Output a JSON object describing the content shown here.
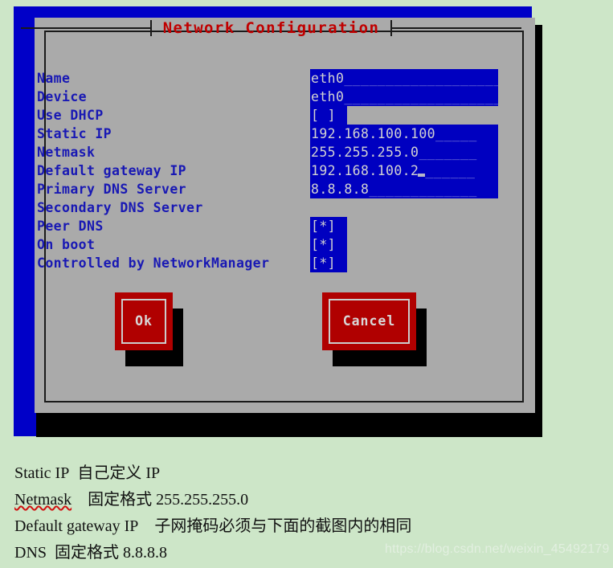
{
  "dialog": {
    "title": "Network Configuration",
    "rows": [
      {
        "label": "Name",
        "type": "text",
        "value": "eth0",
        "fill": "____________________"
      },
      {
        "label": "Device",
        "type": "text",
        "value": "eth0",
        "fill": "____________________"
      },
      {
        "label": "Use DHCP",
        "type": "checkbox",
        "value": "[ ]"
      },
      {
        "label": "Static IP",
        "type": "text",
        "value": "192.168.100.100",
        "fill": "_____"
      },
      {
        "label": "Netmask",
        "type": "text",
        "value": "255.255.255.0",
        "fill": "_______"
      },
      {
        "label": "Default gateway IP",
        "type": "text",
        "value": "192.168.100.2",
        "fill": "______",
        "cursor": true
      },
      {
        "label": "Primary DNS Server",
        "type": "text",
        "value": "8.8.8.8",
        "fill": "_____________"
      },
      {
        "label": "Secondary DNS Server",
        "type": "text",
        "value": "",
        "fill": ""
      },
      {
        "label": "Peer DNS",
        "type": "checkbox",
        "value": "[*]"
      },
      {
        "label": "On boot",
        "type": "checkbox",
        "value": "[*]"
      },
      {
        "label": "Controlled by NetworkManager",
        "type": "checkbox",
        "value": "[*]"
      }
    ],
    "buttons": {
      "ok": "Ok",
      "cancel": "Cancel"
    },
    "colors": {
      "frame_blue": "#0000c8",
      "body_gray": "#aaaaaa",
      "title_red": "#c00000",
      "label_blue": "#1818b4",
      "field_blue": "#0000c0",
      "button_red": "#b00000",
      "page_background": "#cde6c8"
    }
  },
  "notes": {
    "line1_a": "Static IP",
    "line1_b": "自己定义 IP",
    "line2_a": "Netmask",
    "line2_b": "固定格式 255.255.255.0",
    "line3_a": "Default gateway IP",
    "line3_b": "子网掩码必须与下面的截图内的相同",
    "line4_a": "DNS",
    "line4_b": "固定格式  8.8.8.8"
  },
  "watermark": "https://blog.csdn.net/weixin_45492179"
}
